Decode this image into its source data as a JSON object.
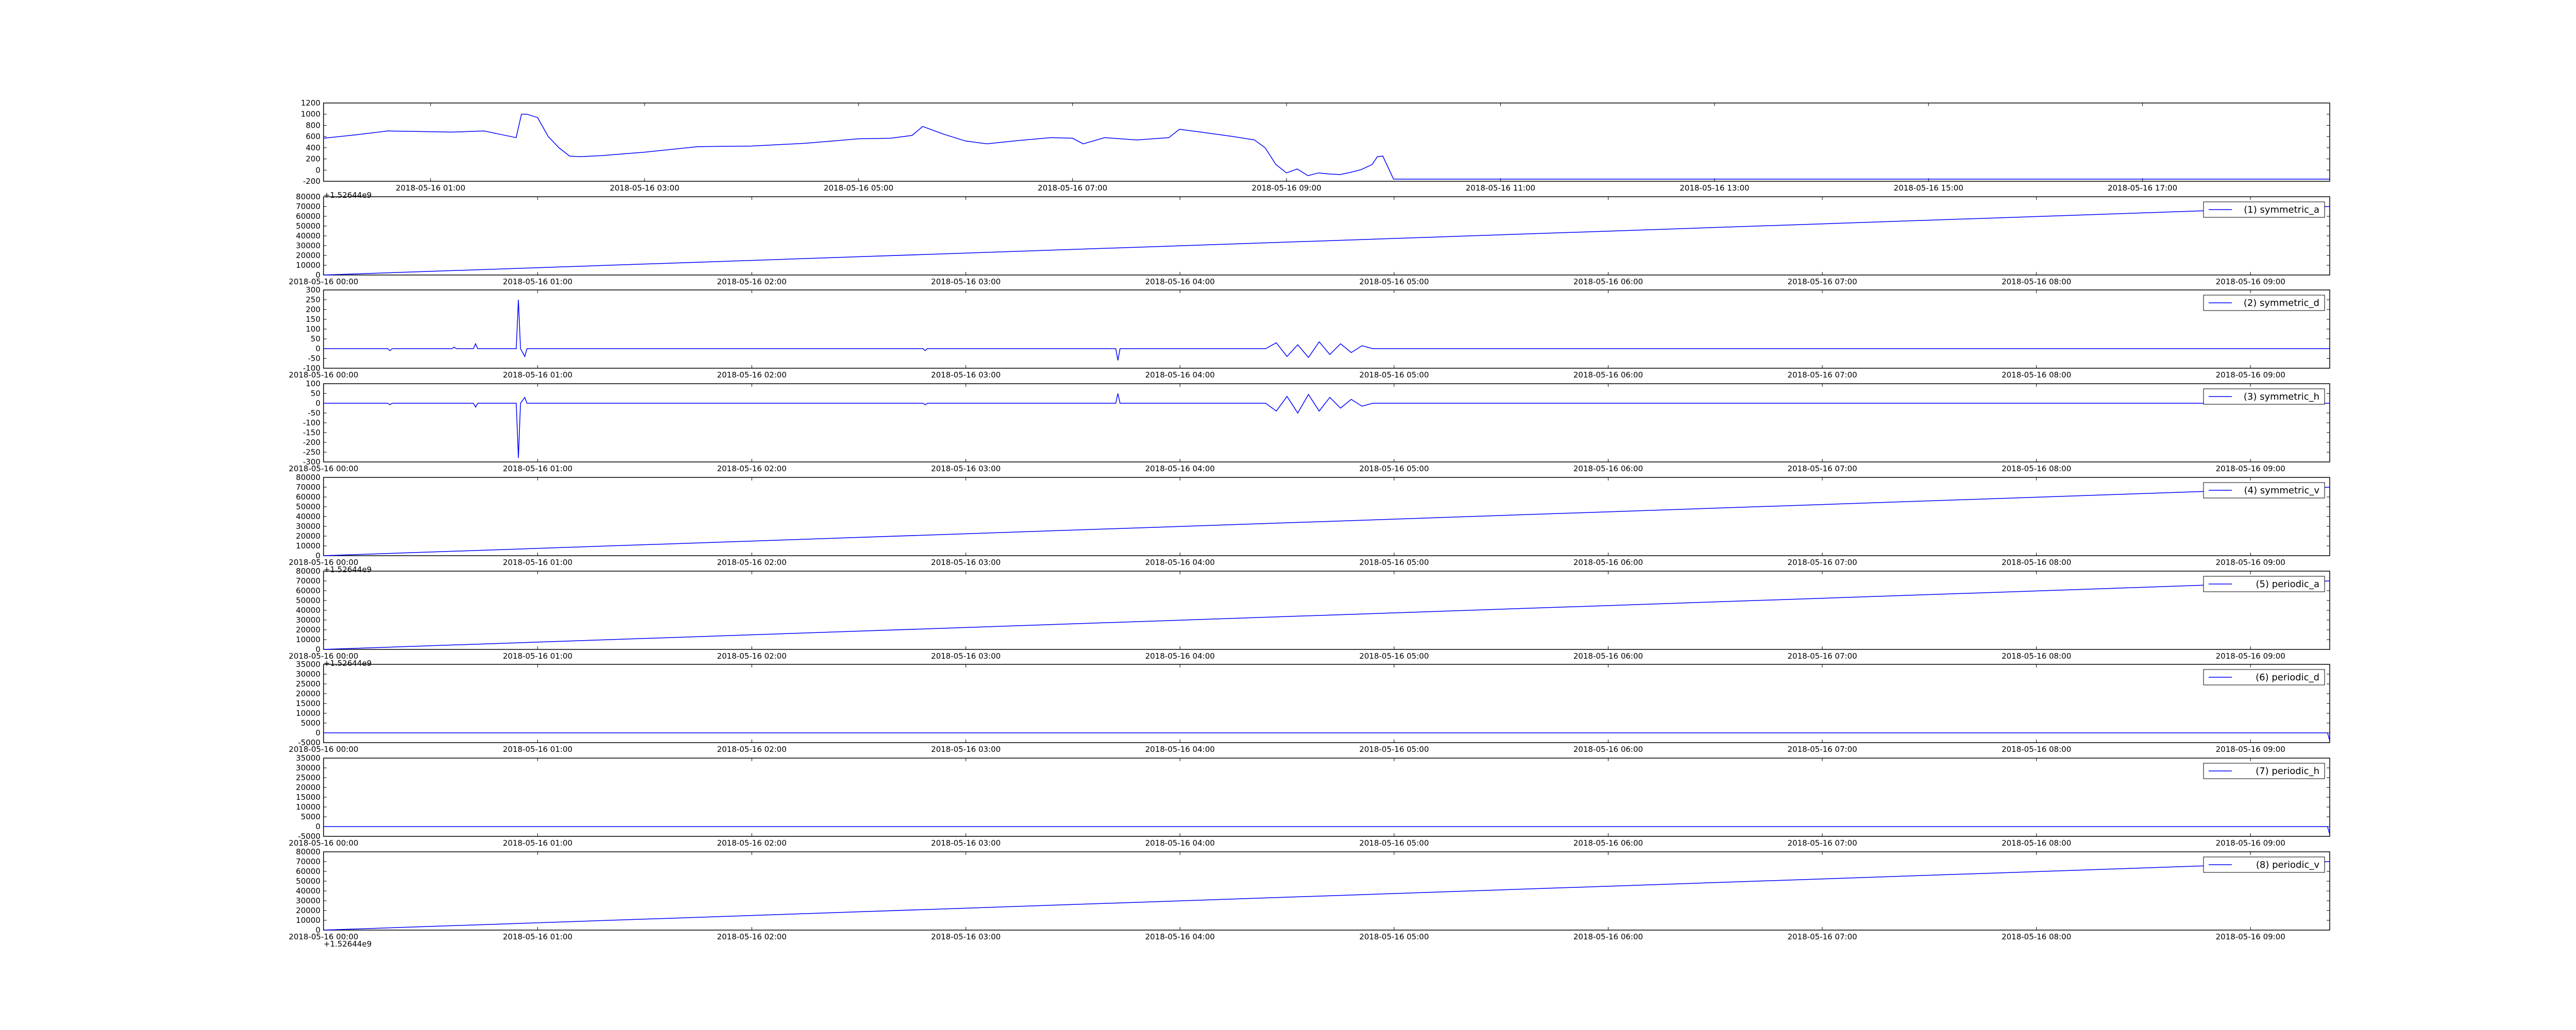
{
  "colors": {
    "line": "#0000ff",
    "axis": "#000000",
    "background": "#ffffff"
  },
  "chart_data": [
    {
      "type": "line",
      "title": "",
      "ylim": [
        -200,
        1200
      ],
      "yticks": [
        -200,
        0,
        200,
        400,
        600,
        800,
        1000,
        1200
      ],
      "offset_label": "+1.52644e9",
      "xticks": [
        "2018-05-16 01:00",
        "2018-05-16 03:00",
        "2018-05-16 05:00",
        "2018-05-16 07:00",
        "2018-05-16 09:00",
        "2018-05-16 11:00",
        "2018-05-16 13:00",
        "2018-05-16 15:00",
        "2018-05-16 17:00"
      ],
      "xtick_values": [
        1,
        3,
        5,
        7,
        9,
        11,
        13,
        15,
        17
      ],
      "xlim": [
        0,
        18.75
      ],
      "legend": "",
      "series": [
        {
          "x": [
            0,
            0.3,
            0.6,
            0.9,
            1.2,
            1.5,
            1.8,
            1.85,
            1.9,
            2.0,
            2.1,
            2.2,
            2.3,
            2.4,
            2.6,
            3.0,
            3.5,
            4.0,
            4.5,
            5.0,
            5.3,
            5.5,
            5.6,
            5.8,
            6.0,
            6.2,
            6.5,
            6.8,
            7.0,
            7.1,
            7.3,
            7.6,
            7.9,
            8.0,
            8.2,
            8.5,
            8.7,
            8.8,
            8.9,
            9.0,
            9.1,
            9.2,
            9.3,
            9.4,
            9.5,
            9.6,
            9.7,
            9.8,
            9.85,
            9.9,
            10.0,
            12.0,
            14.0,
            16.0,
            18.75
          ],
          "y": [
            570,
            630,
            700,
            690,
            680,
            700,
            580,
            1000,
            1000,
            940,
            600,
            400,
            250,
            240,
            260,
            320,
            420,
            430,
            480,
            560,
            570,
            620,
            780,
            640,
            520,
            470,
            530,
            580,
            570,
            470,
            580,
            540,
            580,
            730,
            680,
            600,
            540,
            400,
            100,
            -50,
            20,
            -100,
            -50,
            -70,
            -80,
            -40,
            10,
            100,
            240,
            250,
            -160,
            -160,
            -160,
            -160,
            -160
          ]
        }
      ]
    },
    {
      "type": "line",
      "title": "",
      "ylim": [
        0,
        80000
      ],
      "yticks": [
        0,
        10000,
        20000,
        30000,
        40000,
        50000,
        60000,
        70000,
        80000
      ],
      "offset_label": "",
      "xticks": [
        "2018-05-16 00:00",
        "2018-05-16 01:00",
        "2018-05-16 02:00",
        "2018-05-16 03:00",
        "2018-05-16 04:00",
        "2018-05-16 05:00",
        "2018-05-16 06:00",
        "2018-05-16 07:00",
        "2018-05-16 08:00",
        "2018-05-16 09:00"
      ],
      "xtick_values": [
        0,
        1,
        2,
        3,
        4,
        5,
        6,
        7,
        8,
        9
      ],
      "xlim": [
        0,
        9.37
      ],
      "legend": "(1) symmetric_a",
      "series": [
        {
          "x": [
            0,
            9.37
          ],
          "y": [
            0,
            70000
          ]
        }
      ]
    },
    {
      "type": "line",
      "title": "",
      "ylim": [
        -100,
        300
      ],
      "yticks": [
        -100,
        -50,
        0,
        50,
        100,
        150,
        200,
        250,
        300
      ],
      "offset_label": "",
      "xticks": [
        "2018-05-16 00:00",
        "2018-05-16 01:00",
        "2018-05-16 02:00",
        "2018-05-16 03:00",
        "2018-05-16 04:00",
        "2018-05-16 05:00",
        "2018-05-16 06:00",
        "2018-05-16 07:00",
        "2018-05-16 08:00",
        "2018-05-16 09:00"
      ],
      "xtick_values": [
        0,
        1,
        2,
        3,
        4,
        5,
        6,
        7,
        8,
        9
      ],
      "xlim": [
        0,
        9.37
      ],
      "legend": "(2) symmetric_d",
      "series": [
        {
          "x": [
            0,
            0.3,
            0.31,
            0.32,
            0.6,
            0.61,
            0.62,
            0.7,
            0.71,
            0.72,
            0.9,
            0.91,
            0.92,
            0.94,
            0.95,
            1.0,
            1.5,
            2.0,
            2.8,
            2.81,
            2.82,
            3.7,
            3.71,
            3.72,
            4.4,
            4.45,
            4.5,
            4.55,
            4.6,
            4.65,
            4.7,
            4.75,
            4.8,
            4.85,
            4.9,
            4.91,
            9.37
          ],
          "y": [
            0,
            0,
            -10,
            0,
            0,
            8,
            0,
            0,
            25,
            0,
            0,
            250,
            0,
            -40,
            0,
            0,
            0,
            0,
            0,
            -10,
            0,
            0,
            -60,
            0,
            0,
            30,
            -40,
            20,
            -45,
            35,
            -30,
            25,
            -20,
            15,
            0,
            0,
            0
          ]
        }
      ]
    },
    {
      "type": "line",
      "title": "",
      "ylim": [
        -300,
        100
      ],
      "yticks": [
        -300,
        -250,
        -200,
        -150,
        -100,
        -50,
        0,
        50,
        100
      ],
      "offset_label": "",
      "xticks": [
        "2018-05-16 00:00",
        "2018-05-16 01:00",
        "2018-05-16 02:00",
        "2018-05-16 03:00",
        "2018-05-16 04:00",
        "2018-05-16 05:00",
        "2018-05-16 06:00",
        "2018-05-16 07:00",
        "2018-05-16 08:00",
        "2018-05-16 09:00"
      ],
      "xtick_values": [
        0,
        1,
        2,
        3,
        4,
        5,
        6,
        7,
        8,
        9
      ],
      "xlim": [
        0,
        9.37
      ],
      "legend": "(3) symmetric_h",
      "series": [
        {
          "x": [
            0,
            0.3,
            0.31,
            0.32,
            0.7,
            0.71,
            0.72,
            0.9,
            0.91,
            0.92,
            0.94,
            0.95,
            1.0,
            2.8,
            2.81,
            2.82,
            3.7,
            3.71,
            3.72,
            4.4,
            4.45,
            4.5,
            4.55,
            4.6,
            4.65,
            4.7,
            4.75,
            4.8,
            4.85,
            4.9,
            4.91,
            9.37
          ],
          "y": [
            0,
            0,
            -8,
            0,
            0,
            -20,
            0,
            0,
            -280,
            0,
            30,
            0,
            0,
            0,
            -8,
            0,
            0,
            50,
            0,
            0,
            -40,
            35,
            -50,
            45,
            -40,
            30,
            -25,
            20,
            -15,
            0,
            0,
            0
          ]
        }
      ]
    },
    {
      "type": "line",
      "title": "",
      "ylim": [
        0,
        80000
      ],
      "yticks": [
        0,
        10000,
        20000,
        30000,
        40000,
        50000,
        60000,
        70000,
        80000
      ],
      "offset_label": "+1.52644e9",
      "xticks": [
        "2018-05-16 00:00",
        "2018-05-16 01:00",
        "2018-05-16 02:00",
        "2018-05-16 03:00",
        "2018-05-16 04:00",
        "2018-05-16 05:00",
        "2018-05-16 06:00",
        "2018-05-16 07:00",
        "2018-05-16 08:00",
        "2018-05-16 09:00"
      ],
      "xtick_values": [
        0,
        1,
        2,
        3,
        4,
        5,
        6,
        7,
        8,
        9
      ],
      "xlim": [
        0,
        9.37
      ],
      "legend": "(4) symmetric_v",
      "series": [
        {
          "x": [
            0,
            9.37
          ],
          "y": [
            0,
            70000
          ]
        }
      ]
    },
    {
      "type": "line",
      "title": "",
      "ylim": [
        0,
        80000
      ],
      "yticks": [
        0,
        10000,
        20000,
        30000,
        40000,
        50000,
        60000,
        70000,
        80000
      ],
      "offset_label": "+1.52644e9",
      "xticks": [
        "2018-05-16 00:00",
        "2018-05-16 01:00",
        "2018-05-16 02:00",
        "2018-05-16 03:00",
        "2018-05-16 04:00",
        "2018-05-16 05:00",
        "2018-05-16 06:00",
        "2018-05-16 07:00",
        "2018-05-16 08:00",
        "2018-05-16 09:00"
      ],
      "xtick_values": [
        0,
        1,
        2,
        3,
        4,
        5,
        6,
        7,
        8,
        9
      ],
      "xlim": [
        0,
        9.37
      ],
      "legend": "(5) periodic_a",
      "series": [
        {
          "x": [
            0,
            9.37
          ],
          "y": [
            0,
            70000
          ]
        }
      ]
    },
    {
      "type": "line",
      "title": "",
      "ylim": [
        -5000,
        35000
      ],
      "yticks": [
        -5000,
        0,
        5000,
        10000,
        15000,
        20000,
        25000,
        30000,
        35000
      ],
      "offset_label": "",
      "xticks": [
        "2018-05-16 00:00",
        "2018-05-16 01:00",
        "2018-05-16 02:00",
        "2018-05-16 03:00",
        "2018-05-16 04:00",
        "2018-05-16 05:00",
        "2018-05-16 06:00",
        "2018-05-16 07:00",
        "2018-05-16 08:00",
        "2018-05-16 09:00"
      ],
      "xtick_values": [
        0,
        1,
        2,
        3,
        4,
        5,
        6,
        7,
        8,
        9
      ],
      "xlim": [
        0,
        9.37
      ],
      "legend": "(6) periodic_d",
      "series": [
        {
          "x": [
            0,
            9.36,
            9.37
          ],
          "y": [
            0,
            0,
            -4000
          ]
        }
      ]
    },
    {
      "type": "line",
      "title": "",
      "ylim": [
        -5000,
        35000
      ],
      "yticks": [
        -5000,
        0,
        5000,
        10000,
        15000,
        20000,
        25000,
        30000,
        35000
      ],
      "offset_label": "",
      "xticks": [
        "2018-05-16 00:00",
        "2018-05-16 01:00",
        "2018-05-16 02:00",
        "2018-05-16 03:00",
        "2018-05-16 04:00",
        "2018-05-16 05:00",
        "2018-05-16 06:00",
        "2018-05-16 07:00",
        "2018-05-16 08:00",
        "2018-05-16 09:00"
      ],
      "xtick_values": [
        0,
        1,
        2,
        3,
        4,
        5,
        6,
        7,
        8,
        9
      ],
      "xlim": [
        0,
        9.37
      ],
      "legend": "(7) periodic_h",
      "series": [
        {
          "x": [
            0,
            9.36,
            9.37
          ],
          "y": [
            0,
            0,
            -4000
          ]
        }
      ]
    },
    {
      "type": "line",
      "title": "",
      "ylim": [
        0,
        80000
      ],
      "yticks": [
        0,
        10000,
        20000,
        30000,
        40000,
        50000,
        60000,
        70000,
        80000
      ],
      "offset_label": "+1.52644e9",
      "xticks": [
        "2018-05-16 00:00",
        "2018-05-16 01:00",
        "2018-05-16 02:00",
        "2018-05-16 03:00",
        "2018-05-16 04:00",
        "2018-05-16 05:00",
        "2018-05-16 06:00",
        "2018-05-16 07:00",
        "2018-05-16 08:00",
        "2018-05-16 09:00"
      ],
      "xtick_values": [
        0,
        1,
        2,
        3,
        4,
        5,
        6,
        7,
        8,
        9
      ],
      "xlim": [
        0,
        9.37
      ],
      "legend": "(8) periodic_v",
      "series": [
        {
          "x": [
            0,
            9.37
          ],
          "y": [
            0,
            70000
          ]
        }
      ]
    }
  ]
}
